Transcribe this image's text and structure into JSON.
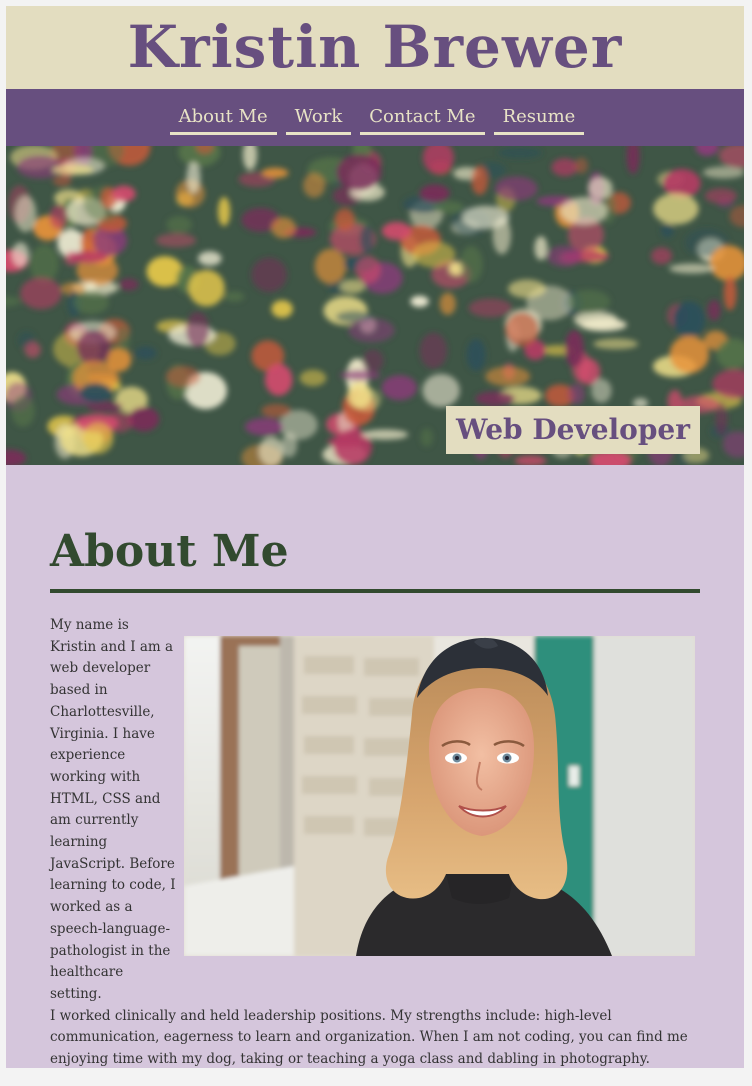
{
  "header": {
    "title": "Kristin Brewer"
  },
  "nav": {
    "items": [
      {
        "label": "About Me"
      },
      {
        "label": "Work"
      },
      {
        "label": "Contact Me"
      },
      {
        "label": "Resume"
      }
    ]
  },
  "hero": {
    "badge": "Web Developer"
  },
  "about": {
    "heading": "About Me",
    "paragraph_left": "My name is Kristin and I am a web developer based in Charlottesville, Virginia. I have experience working with HTML, CSS and am currently learning JavaScript. Before learning to code, I worked as a speech-language-pathologist in the healthcare setting.",
    "paragraph_rest": "I worked clinically and held leadership positions. My strengths include: high-level communication, eagerness to learn and organization. When I am not coding, you can find me enjoying time with my dog, taking or teaching a yoga class and dabling in photography."
  },
  "colors": {
    "accent_purple": "#674f7f",
    "cream": "#e3ddc0",
    "lavender": "#d5c6dc",
    "forest_green": "#324a2f"
  }
}
